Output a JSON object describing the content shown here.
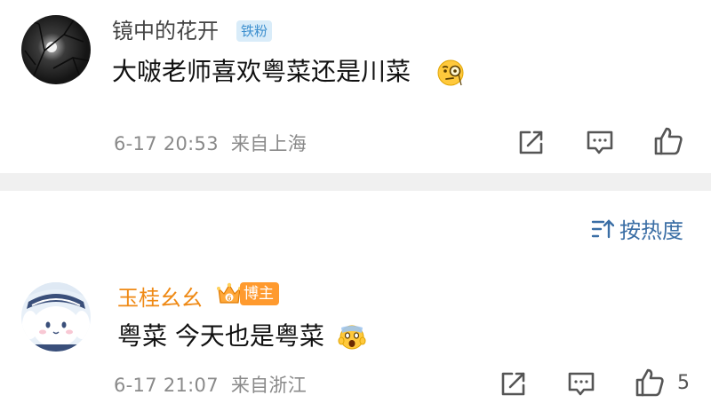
{
  "comments": [
    {
      "username": "镜中的花开",
      "badge": "铁粉",
      "text": "大啵老师喜欢粤菜还是川菜",
      "emoji_icon": "monocle-face-icon",
      "time": "6-17 20:53",
      "location": "来自上海"
    },
    {
      "username": "玉桂幺幺",
      "badge": "博主",
      "text": "粤菜 今天也是粤菜",
      "emoji_icon": "screaming-face-icon",
      "time": "6-17 21:07",
      "location": "来自浙江",
      "like_count": "5"
    }
  ],
  "sort": {
    "label": "按热度",
    "icon": "sort-icon"
  },
  "icons": {
    "share": "share-icon",
    "reply": "comment-icon",
    "like": "thumbs-up-icon"
  },
  "colors": {
    "blogger_name": "#ef8a16",
    "blogger_badge": "#ff9a2e",
    "fan_badge_bg": "#d9ecf9",
    "fan_badge_text": "#3d8fce",
    "sort_link": "#3a6ea5",
    "divider": "#f0f0f0"
  }
}
